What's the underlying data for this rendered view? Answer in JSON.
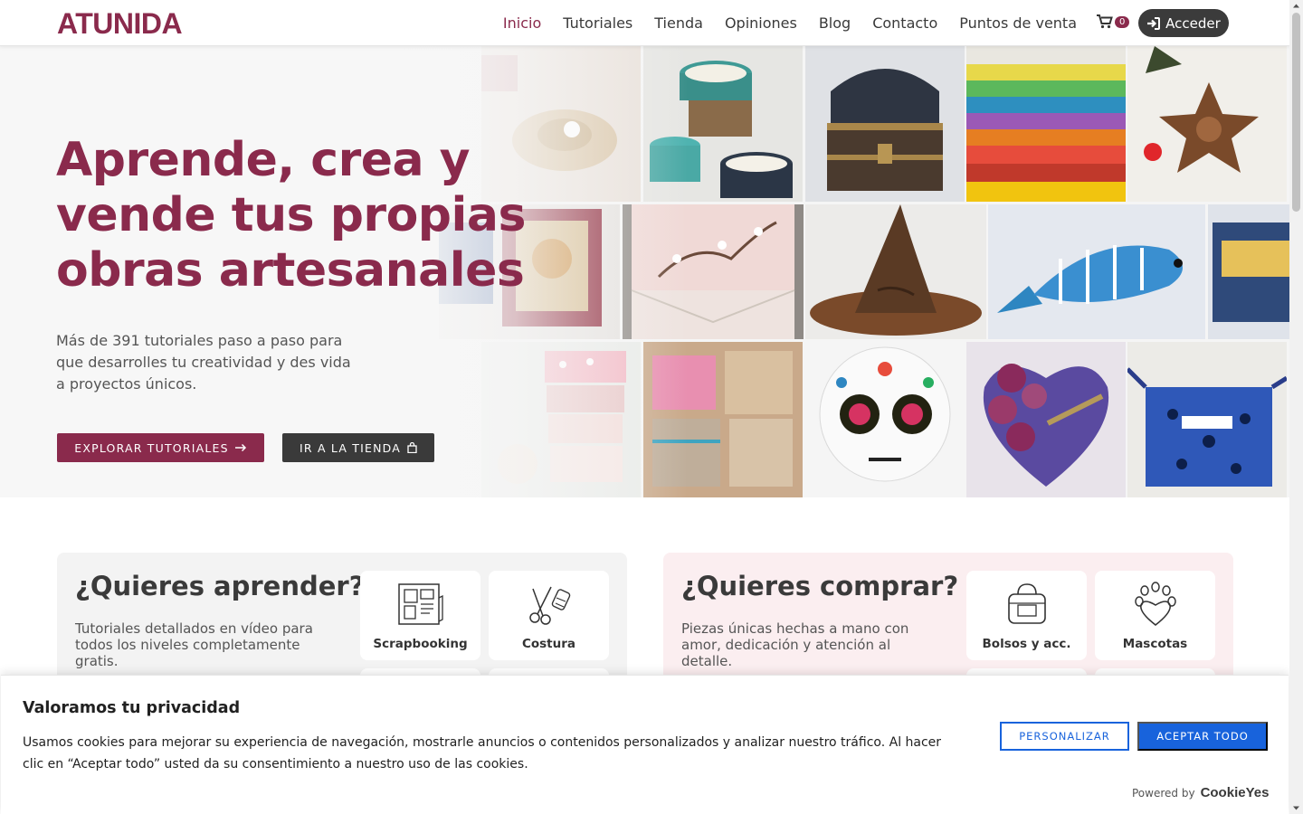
{
  "brand": {
    "logo_text": "ATUNIDA",
    "color": "#8a2a4c"
  },
  "nav": {
    "items": [
      {
        "label": "Inicio",
        "active": true
      },
      {
        "label": "Tutoriales",
        "active": false
      },
      {
        "label": "Tienda",
        "active": false
      },
      {
        "label": "Opiniones",
        "active": false
      },
      {
        "label": "Blog",
        "active": false
      },
      {
        "label": "Contacto",
        "active": false
      },
      {
        "label": "Puntos de venta",
        "active": false
      }
    ],
    "cart_count": "0",
    "cart_icon": "shopping-cart-icon",
    "login_label": "Acceder",
    "login_icon": "sign-in-icon"
  },
  "hero": {
    "title": "Aprende, crea y vende tus propias obras artesanales",
    "subtitle": "Más de 391 tutoriales paso a paso para que desarrolles tu creatividad y des vida a proyectos únicos.",
    "explore_label": "EXPLORAR TUTORIALES",
    "shop_label": "IR A LA TIENDA"
  },
  "learn": {
    "title": "¿Quieres aprender?",
    "description": "Tutoriales detallados en vídeo para todos los niveles completamente gratis.",
    "categories": [
      {
        "label": "Scrapbooking",
        "icon": "scrapbook-icon"
      },
      {
        "label": "Costura",
        "icon": "sewing-scissors-icon"
      }
    ]
  },
  "buy": {
    "title": "¿Quieres comprar?",
    "description": "Piezas únicas hechas a mano con amor, dedicación y atención al detalle.",
    "categories": [
      {
        "label": "Bolsos y acc.",
        "icon": "bag-icon"
      },
      {
        "label": "Mascotas",
        "icon": "paw-heart-icon"
      }
    ]
  },
  "cookie": {
    "title": "Valoramos tu privacidad",
    "text": "Usamos cookies para mejorar su experiencia de navegación, mostrarle anuncios o contenidos personalizados y analizar nuestro tráfico. Al hacer clic en “Aceptar todo” usted da su consentimiento a nuestro uso de las cookies.",
    "customize_label": "PERSONALIZAR",
    "accept_label": "ACEPTAR TODO",
    "powered_label": "Powered by",
    "powered_brand": "CookieYes",
    "accent": "#1863dc"
  }
}
